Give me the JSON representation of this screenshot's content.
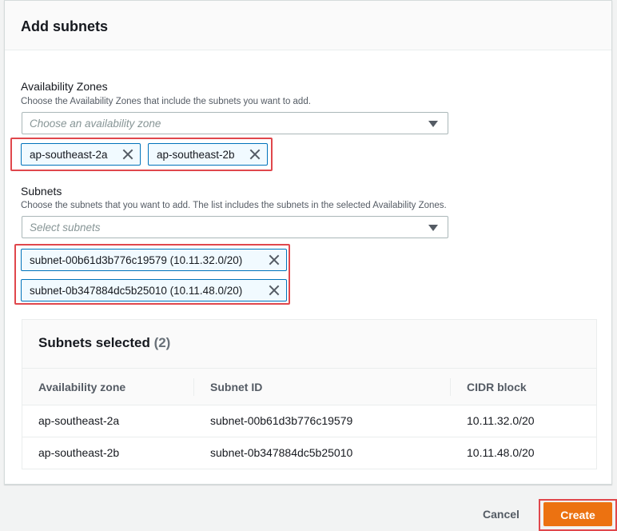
{
  "panel": {
    "title": "Add subnets"
  },
  "availability_zones": {
    "label": "Availability Zones",
    "description": "Choose the Availability Zones that include the subnets you want to add.",
    "placeholder": "Choose an availability zone",
    "tokens": [
      "ap-southeast-2a",
      "ap-southeast-2b"
    ]
  },
  "subnets": {
    "label": "Subnets",
    "description": "Choose the subnets that you want to add. The list includes the subnets in the selected Availability Zones.",
    "placeholder": "Select subnets",
    "tokens": [
      "subnet-00b61d3b776c19579 (10.11.32.0/20)",
      "subnet-0b347884dc5b25010 (10.11.48.0/20)"
    ]
  },
  "table": {
    "title": "Subnets selected",
    "count": "(2)",
    "columns": [
      "Availability zone",
      "Subnet ID",
      "CIDR block"
    ],
    "rows": [
      [
        "ap-southeast-2a",
        "subnet-00b61d3b776c19579",
        "10.11.32.0/20"
      ],
      [
        "ap-southeast-2b",
        "subnet-0b347884dc5b25010",
        "10.11.48.0/20"
      ]
    ]
  },
  "footer": {
    "cancel_label": "Cancel",
    "create_label": "Create"
  },
  "colors": {
    "primary_button": "#ec7211",
    "token_border": "#0073bb",
    "highlight": "#e0474c"
  }
}
